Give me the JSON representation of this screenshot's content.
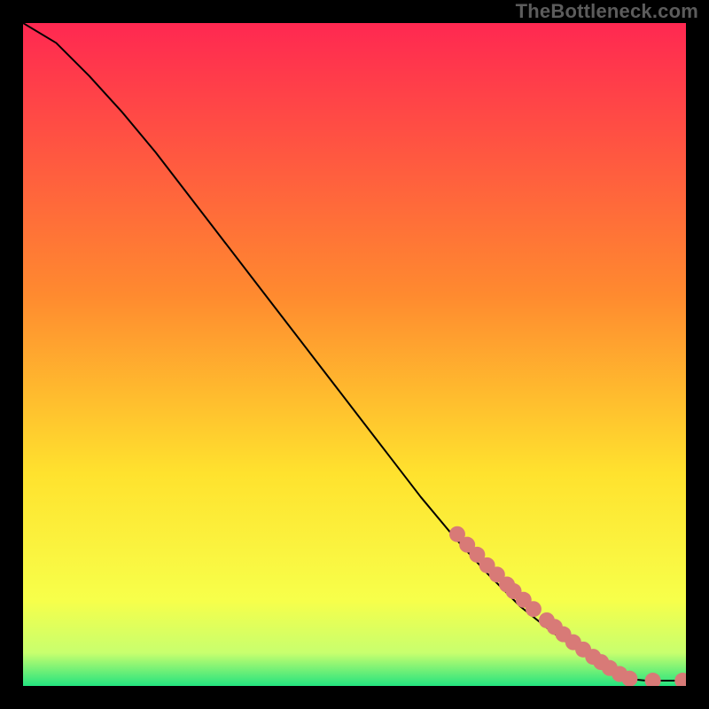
{
  "watermark": "TheBottleneck.com",
  "colors": {
    "gradient_top": "#ff2851",
    "gradient_mid1": "#ff8a2f",
    "gradient_mid2": "#ffe22e",
    "gradient_mid3": "#f7ff4a",
    "gradient_mid4": "#c8ff6e",
    "gradient_bottom": "#24e37f",
    "line": "#000000",
    "marker": "#d87a77",
    "frame": "#000000"
  },
  "chart_data": {
    "type": "line",
    "title": "",
    "xlabel": "",
    "ylabel": "",
    "xlim": [
      0,
      100
    ],
    "ylim": [
      0,
      100
    ],
    "series": [
      {
        "name": "curve",
        "x": [
          0,
          5,
          10,
          15,
          20,
          25,
          30,
          35,
          40,
          45,
          50,
          55,
          60,
          65,
          70,
          75,
          80,
          85,
          88,
          90,
          92,
          94,
          96,
          98,
          100
        ],
        "y": [
          100,
          97,
          92,
          86.5,
          80.5,
          74,
          67.5,
          61,
          54.5,
          48,
          41.5,
          35,
          28.5,
          22.5,
          17,
          12,
          8,
          4.5,
          2.5,
          1.5,
          1,
          0.8,
          0.8,
          0.8,
          0.8
        ]
      }
    ],
    "markers": {
      "name": "points",
      "x": [
        65.5,
        67,
        68.5,
        70,
        71.5,
        73,
        74,
        75.5,
        77,
        79,
        80.2,
        81.5,
        83,
        84.5,
        86,
        87.2,
        88.5,
        90,
        91.5,
        95,
        99.5
      ],
      "y": [
        22.9,
        21.3,
        19.8,
        18.2,
        16.8,
        15.3,
        14.3,
        13.0,
        11.6,
        9.9,
        8.9,
        7.8,
        6.6,
        5.5,
        4.4,
        3.6,
        2.7,
        1.8,
        1.1,
        0.8,
        0.8
      ],
      "color": "#d87a77",
      "radius": 9
    },
    "legend": [],
    "grid": false
  }
}
